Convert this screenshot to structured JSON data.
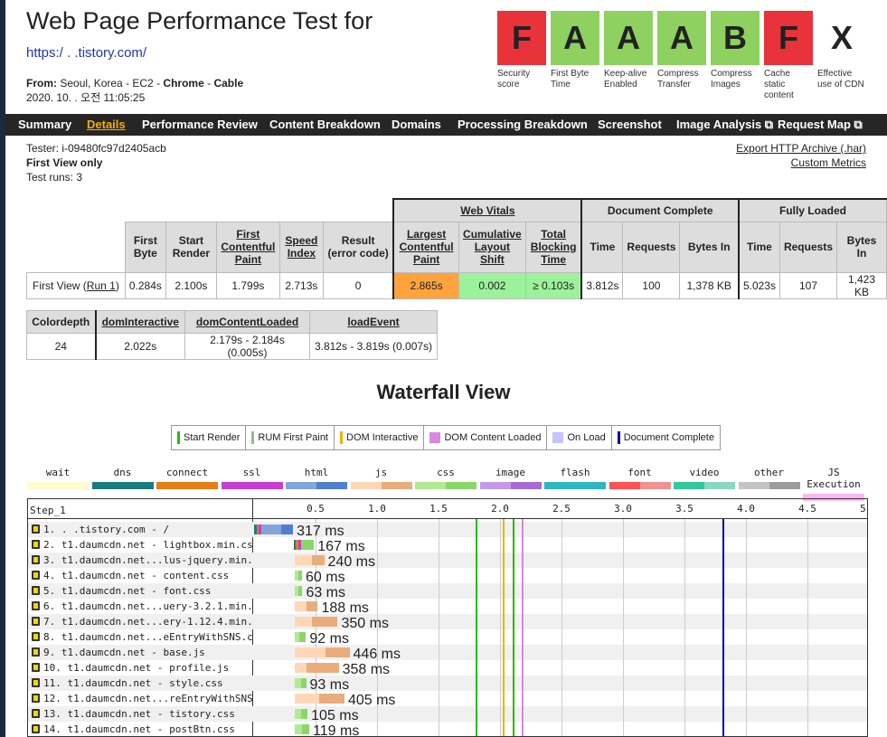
{
  "header": {
    "title": "Web Page Performance Test for",
    "url": "https:/ .              .tistory.com/",
    "from_label": "From:",
    "from_location": "Seoul, Korea - EC2 -",
    "browser": "Chrome",
    "sep": "-",
    "connection": "Cable",
    "datetime": "2020. 10.   . 오전 11:05:25"
  },
  "grades": [
    {
      "letter": "F",
      "label": "Security score",
      "color": "#e8333b"
    },
    {
      "letter": "A",
      "label": "First Byte Time",
      "color": "#8ed160"
    },
    {
      "letter": "A",
      "label": "Keep-alive Enabled",
      "color": "#8ed160"
    },
    {
      "letter": "A",
      "label": "Compress Transfer",
      "color": "#8ed160"
    },
    {
      "letter": "B",
      "label": "Compress Images",
      "color": "#8ed160"
    },
    {
      "letter": "F",
      "label": "Cache static content",
      "color": "#e8333b"
    },
    {
      "letter": "X",
      "label": "Effective use of CDN",
      "color": "#ffffff"
    }
  ],
  "nav": [
    "Summary",
    "Details",
    "Performance Review",
    "Content Breakdown",
    "Domains",
    "Processing Breakdown",
    "Screenshot",
    "Image Analysis ⧉",
    "Request Map ⧉"
  ],
  "tester": {
    "tester_line": "Tester: i-09480fc97d2405acb",
    "view_line": "First View only",
    "runs_line": "Test runs: 3",
    "export_link": "Export HTTP Archive (.har)",
    "metrics_link": "Custom Metrics"
  },
  "results": {
    "group_web_vitals": "Web Vitals",
    "group_doc_complete": "Document Complete",
    "group_fully_loaded": "Fully Loaded",
    "h_first_byte": "First Byte",
    "h_start_render": "Start Render",
    "h_fcp": "First Contentful Paint",
    "h_speed_index": "Speed Index",
    "h_result": "Result (error code)",
    "h_lcp": "Largest Contentful Paint",
    "h_cls": "Cumulative Layout Shift",
    "h_tbt": "Total Blocking Time",
    "h_time": "Time",
    "h_requests": "Requests",
    "h_bytes": "Bytes In",
    "row_label": "First View (",
    "run_link": "Run 1",
    "row_label_end": ")",
    "first_byte": "0.284s",
    "start_render": "2.100s",
    "fcp": "1.799s",
    "speed_index": "2.713s",
    "result": "0",
    "lcp": "2.865s",
    "cls": "0.002",
    "tbt": "≥ 0.103s",
    "dc_time": "3.812s",
    "dc_requests": "100",
    "dc_bytes": "1,378 KB",
    "fl_time": "5.023s",
    "fl_requests": "107",
    "fl_bytes": "1,423 KB"
  },
  "results2": {
    "h_colordepth": "Colordepth",
    "h_dom_interactive": "domInteractive",
    "h_dcl": "domContentLoaded",
    "h_load": "loadEvent",
    "colordepth": "24",
    "dom_interactive": "2.022s",
    "dcl": "2.179s - 2.184s (0.005s)",
    "load": "3.812s - 3.819s (0.007s)"
  },
  "waterfall": {
    "title": "Waterfall View",
    "legend": [
      {
        "label": "Start Render",
        "color": "#28bc00",
        "kind": "line"
      },
      {
        "label": "RUM First Paint",
        "color": "#8fbc8f",
        "kind": "line"
      },
      {
        "label": "DOM Interactive",
        "color": "#f2b100",
        "kind": "line"
      },
      {
        "label": "DOM Content Loaded",
        "color": "#d888df",
        "kind": "box"
      },
      {
        "label": "On Load",
        "color": "#c4c4ff",
        "kind": "box"
      },
      {
        "label": "Document Complete",
        "color": "#0000aa",
        "kind": "line"
      }
    ],
    "types": [
      {
        "label": "wait",
        "c1": "#fefccd",
        "c2": "#fefccd"
      },
      {
        "label": "dns",
        "c1": "#1c7c7c",
        "c2": "#1c7c7c"
      },
      {
        "label": "connect",
        "c1": "#e57d18",
        "c2": "#e57d18"
      },
      {
        "label": "ssl",
        "c1": "#c53fd2",
        "c2": "#c53fd2"
      },
      {
        "label": "html",
        "c1": "#82a5dc",
        "c2": "#4f80d0"
      },
      {
        "label": "js",
        "c1": "#fed8b6",
        "c2": "#e8ad7b"
      },
      {
        "label": "css",
        "c1": "#b2ea94",
        "c2": "#8ad768"
      },
      {
        "label": "image",
        "c1": "#c49ae8",
        "c2": "#a76bd8"
      },
      {
        "label": "flash",
        "c1": "#2db7c1",
        "c2": "#2db7c1"
      },
      {
        "label": "font",
        "c1": "#ff5251",
        "c2": "#f19292"
      },
      {
        "label": "video",
        "c1": "#33c79c",
        "c2": "#8ad7c0"
      },
      {
        "label": "other",
        "c1": "#c4c4c4",
        "c2": "#9c9c9c"
      },
      {
        "label": "JS Execution",
        "c1": "#ffb6f5",
        "c2": "#ffb6f5"
      }
    ],
    "step_label": "Step_1",
    "ticks": [
      "0.5",
      "1.0",
      "1.5",
      "2.0",
      "2.5",
      "3.0",
      "3.5",
      "4.0",
      "4.5",
      "5.0"
    ],
    "x_range": [
      0,
      5.0
    ],
    "markers": [
      {
        "name": "start-render",
        "t": 2.1,
        "color": "#28bc00"
      },
      {
        "name": "rum-first-paint",
        "t": 1.799,
        "color": "#28bc00"
      },
      {
        "name": "dom-interactive",
        "t": 2.022,
        "color": "#f2b100"
      },
      {
        "name": "dom-content-loaded",
        "t": 2.18,
        "color": "#d888df"
      },
      {
        "name": "document-complete",
        "t": 3.812,
        "color": "#0000aa"
      }
    ],
    "requests": [
      {
        "label": "1. .              .tistory.com - /",
        "start": 0.0,
        "wait": 0.16,
        "dur": 0.317,
        "type": "html",
        "ms": "317 ms",
        "conn": true
      },
      {
        "label": "2. t1.daumcdn.net - lightbox.min.css",
        "start": 0.32,
        "wait": 0.0,
        "dur": 0.167,
        "type": "css",
        "ms": "167 ms",
        "conn": true
      },
      {
        "label": "3. t1.daumcdn.net...lus-jquery.min.js",
        "start": 0.33,
        "wait": 0.14,
        "dur": 0.24,
        "type": "js",
        "ms": "240 ms"
      },
      {
        "label": "4. t1.daumcdn.net - content.css",
        "start": 0.33,
        "wait": 0.03,
        "dur": 0.06,
        "type": "css",
        "ms": "60 ms"
      },
      {
        "label": "5. t1.daumcdn.net - font.css",
        "start": 0.33,
        "wait": 0.03,
        "dur": 0.063,
        "type": "css",
        "ms": "63 ms"
      },
      {
        "label": "6. t1.daumcdn.net...uery-3.2.1.min.js",
        "start": 0.33,
        "wait": 0.1,
        "dur": 0.188,
        "type": "js",
        "ms": "188 ms"
      },
      {
        "label": "7. t1.daumcdn.net...ery-1.12.4.min.js",
        "start": 0.33,
        "wait": 0.14,
        "dur": 0.35,
        "type": "js",
        "ms": "350 ms"
      },
      {
        "label": "8. t1.daumcdn.net...eEntryWithSNS.css",
        "start": 0.33,
        "wait": 0.04,
        "dur": 0.092,
        "type": "css",
        "ms": "92 ms"
      },
      {
        "label": "9. t1.daumcdn.net - base.js",
        "start": 0.33,
        "wait": 0.25,
        "dur": 0.446,
        "type": "js",
        "ms": "446 ms"
      },
      {
        "label": "10. t1.daumcdn.net - profile.js",
        "start": 0.33,
        "wait": 0.1,
        "dur": 0.358,
        "type": "js",
        "ms": "358 ms"
      },
      {
        "label": "11. t1.daumcdn.net - style.css",
        "start": 0.33,
        "wait": 0.05,
        "dur": 0.093,
        "type": "css",
        "ms": "93 ms"
      },
      {
        "label": "12. t1.daumcdn.net...reEntryWithSNS.js",
        "start": 0.33,
        "wait": 0.2,
        "dur": 0.405,
        "type": "js",
        "ms": "405 ms"
      },
      {
        "label": "13. t1.daumcdn.net - tistory.css",
        "start": 0.33,
        "wait": 0.05,
        "dur": 0.105,
        "type": "css",
        "ms": "105 ms"
      },
      {
        "label": "14. t1.daumcdn.net - postBtn.css",
        "start": 0.33,
        "wait": 0.06,
        "dur": 0.119,
        "type": "css",
        "ms": "119 ms"
      }
    ]
  }
}
